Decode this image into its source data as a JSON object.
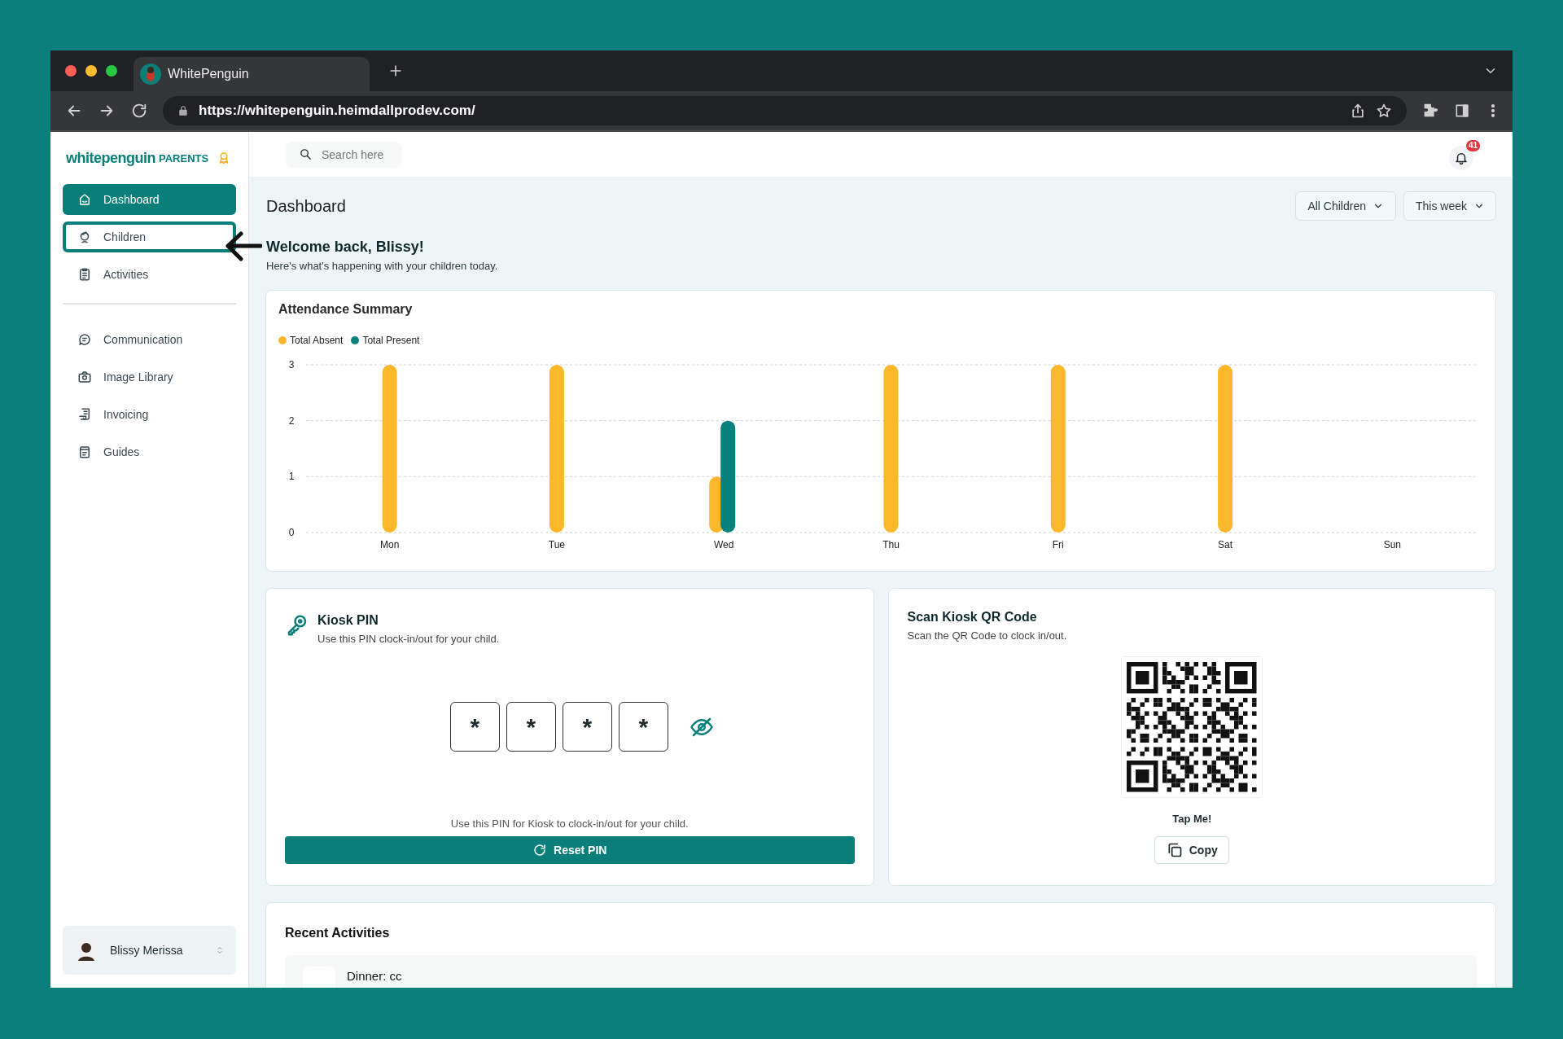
{
  "browser": {
    "tab_title": "WhitePenguin",
    "url": "https://whitepenguin.heimdallprodev.com/"
  },
  "sidebar": {
    "logo": {
      "brand": "whitepenguin",
      "suffix": "PARENTS"
    },
    "groups": [
      [
        {
          "label": "Dashboard",
          "selected": true,
          "highlighted": false
        },
        {
          "label": "Children",
          "selected": false,
          "highlighted": true
        },
        {
          "label": "Activities",
          "selected": false,
          "highlighted": false
        }
      ],
      [
        {
          "label": "Communication",
          "selected": false,
          "highlighted": false
        },
        {
          "label": "Image Library",
          "selected": false,
          "highlighted": false
        },
        {
          "label": "Invoicing",
          "selected": false,
          "highlighted": false
        },
        {
          "label": "Guides",
          "selected": false,
          "highlighted": false
        }
      ]
    ],
    "user": {
      "name": "Blissy Merissa"
    }
  },
  "header": {
    "search": {
      "placeholder": "Search here"
    },
    "notifications": "41"
  },
  "dashboard": {
    "title": "Dashboard",
    "filters": [
      {
        "label": "All Children"
      },
      {
        "label": "This week"
      }
    ],
    "welcome": "Welcome back, Blissy!",
    "subtitle": "Here's what's happening with your children today."
  },
  "attendance": {
    "title": "Attendance Summary",
    "chart_data": {
      "type": "bar",
      "categories": [
        "Mon",
        "Tue",
        "Wed",
        "Thu",
        "Fri",
        "Sat",
        "Sun"
      ],
      "series": [
        {
          "name": "Total Absent",
          "color": "#fbb829",
          "values": [
            3,
            3,
            1,
            3,
            3,
            3,
            0
          ]
        },
        {
          "name": "Total Present",
          "color": "#08807b",
          "values": [
            0,
            0,
            2,
            0,
            0,
            0,
            0
          ]
        }
      ],
      "ylim": [
        0,
        3
      ],
      "yticks": [
        0,
        1,
        2,
        3
      ]
    }
  },
  "kiosk_pin": {
    "title": "Kiosk PIN",
    "subtitle": "Use this PIN clock-in/out for your child.",
    "digits": [
      "*",
      "*",
      "*",
      "*"
    ],
    "note": "Use this PIN for Kiosk to clock-in/out for your child.",
    "button": "Reset PIN"
  },
  "kiosk_qr": {
    "title": "Scan Kiosk QR Code",
    "subtitle": "Scan the QR Code to clock in/out.",
    "caption": "Tap Me!",
    "button": "Copy"
  },
  "recent": {
    "title": "Recent Activities",
    "items": [
      {
        "title": "Dinner: cc"
      }
    ]
  }
}
